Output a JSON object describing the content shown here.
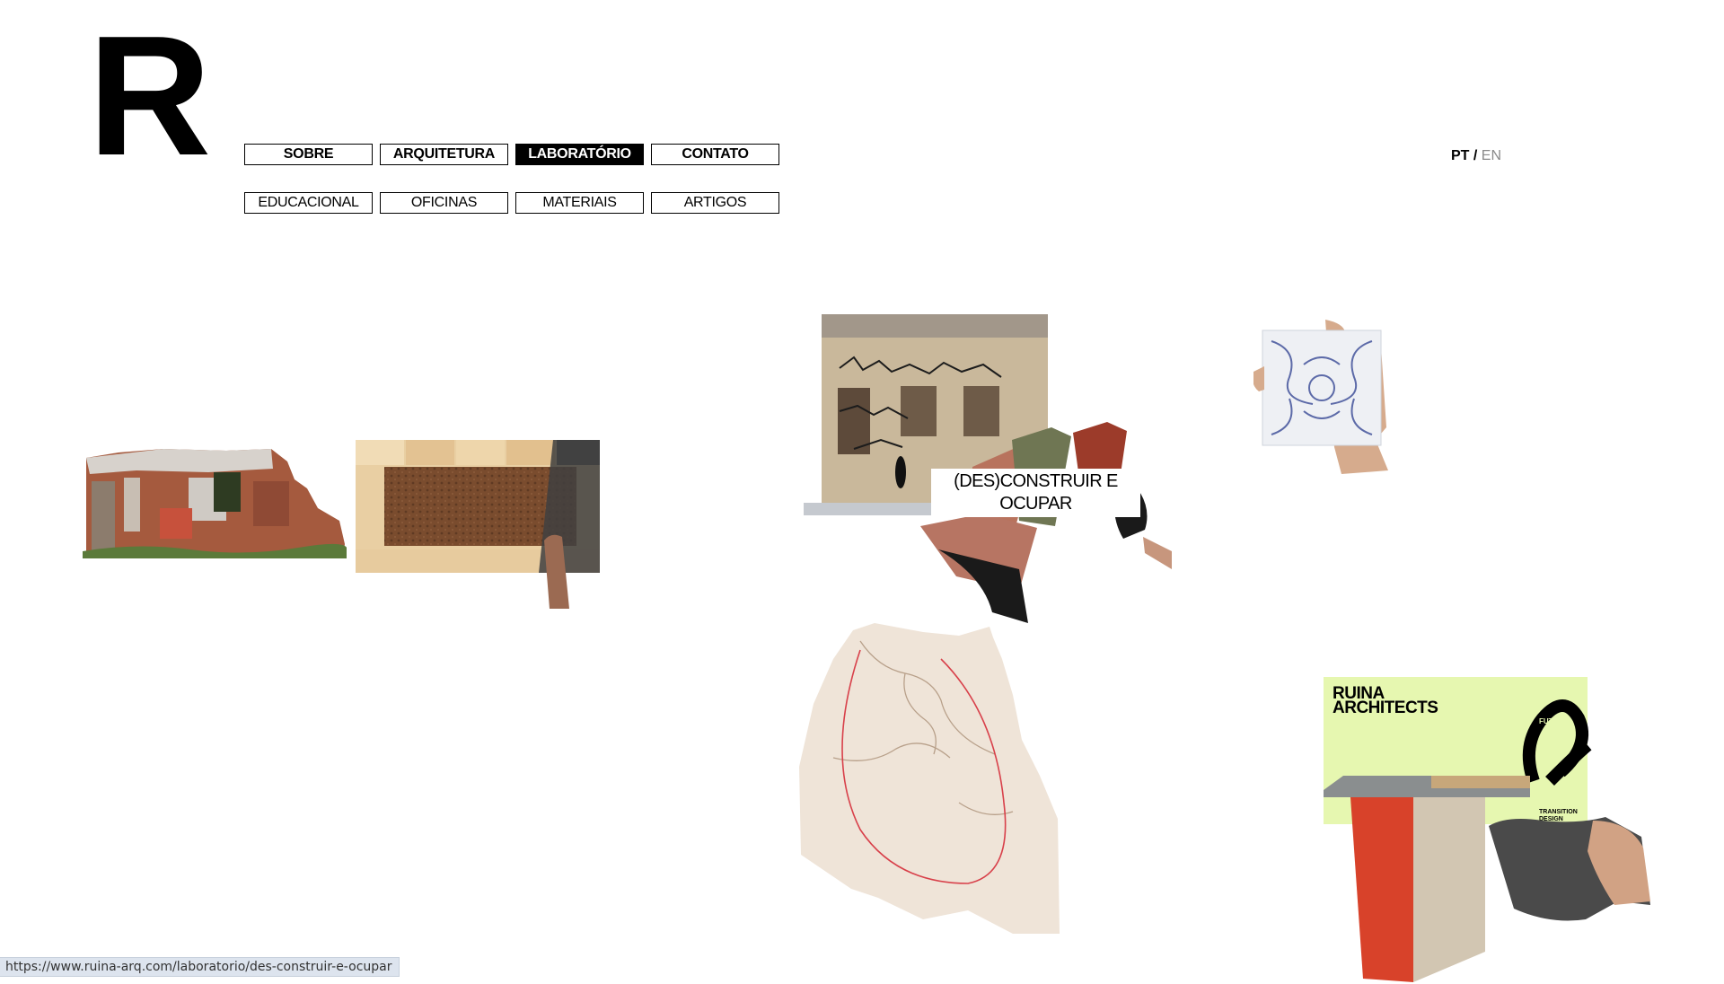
{
  "logo": {
    "letter": "R"
  },
  "nav": {
    "primary": [
      {
        "label": "SOBRE",
        "active": false
      },
      {
        "label": "ARQUITETURA",
        "active": false
      },
      {
        "label": "LABORATÓRIO",
        "active": true
      },
      {
        "label": "CONTATO",
        "active": false
      }
    ],
    "secondary": [
      {
        "label": "EDUCACIONAL"
      },
      {
        "label": "OFICINAS"
      },
      {
        "label": "MATERIAIS"
      },
      {
        "label": "ARTIGOS"
      }
    ]
  },
  "language": {
    "pt": "PT",
    "separator": " / ",
    "en": "EN",
    "active": "PT"
  },
  "projects": {
    "featured_caption": "(DES)CONSTRUIR E OCUPAR",
    "poster": {
      "brand_line1": "RUINA",
      "brand_line2": "ARCHITECTS",
      "loop_text": "FUTURE",
      "corner_line1": "TRANSITION",
      "corner_line2": "DESIGN"
    }
  },
  "status_bar": {
    "url": "https://www.ruina-arq.com/laboratorio/des-construir-e-ocupar"
  },
  "colors": {
    "active_bg": "#000000",
    "inactive_lang": "#8a8a8a",
    "poster_bg": "#e6f7b0",
    "stool_red": "#d8422a"
  }
}
